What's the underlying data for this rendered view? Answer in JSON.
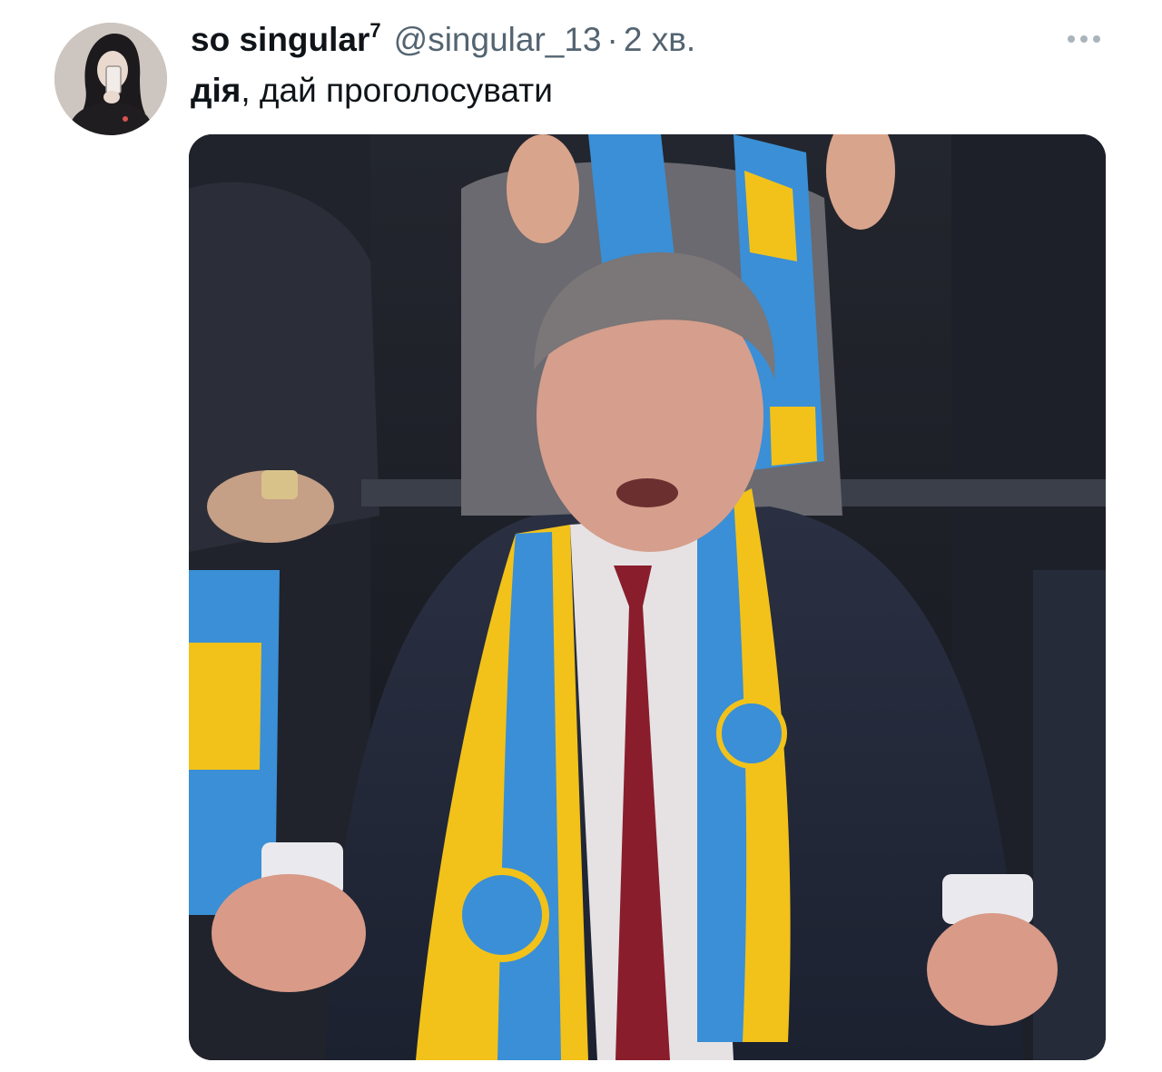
{
  "tweet": {
    "author": {
      "display_name": "so singular",
      "display_name_sup": "7",
      "handle": "@singular_13",
      "avatar_icon": "avatar-icon"
    },
    "separator": "·",
    "timestamp": "2 хв.",
    "more_icon": "more-horizontal-icon",
    "text": {
      "highlight": "дія",
      "rest": ", дай проголосувати"
    },
    "media": {
      "scarf_colors": {
        "blue": "#3a8fd6",
        "yellow": "#f2c21a"
      }
    }
  }
}
